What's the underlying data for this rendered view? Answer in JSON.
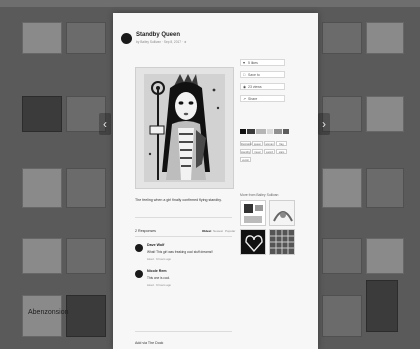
{
  "artwork": {
    "title": "Standby Queen",
    "byline": "by Bailey Sullivan · Sep 8, 2017 · ★",
    "caption": "The feeling when a girl finally confirmed flying standby."
  },
  "actions": [
    {
      "icon": "heart-icon",
      "label": "5 likes"
    },
    {
      "icon": "bookmark-icon",
      "label": "Save to"
    },
    {
      "icon": "eye-icon",
      "label": "23 views"
    },
    {
      "icon": "share-icon",
      "label": "Share"
    }
  ],
  "palette": [
    "#111111",
    "#3a3a3a",
    "#b5b5b5",
    "#d8d8d8",
    "#8f8f8f",
    "#5c5c5c"
  ],
  "tags": [
    "illustration",
    "queen",
    "woman",
    "flag",
    "standby",
    "travel",
    "sword",
    "stars",
    "vector"
  ],
  "more_from": {
    "label": "More from Bailey Sullivan"
  },
  "responses": {
    "count_label": "2 Responses",
    "sort": [
      "Oldest",
      "Newest",
      "Popular"
    ],
    "items": [
      {
        "name": "Dave Wolf",
        "text": "What! This girl was freaking cool stuff dreams!!",
        "meta": "Liked · 9 hours ago"
      },
      {
        "name": "Nicole Rem",
        "text": "This one is cool.",
        "meta": "Liked · 9 hours ago"
      }
    ]
  },
  "footer": {
    "label": "Add via The Dock"
  },
  "background": {
    "caption_left": "Abenzonsion"
  },
  "colors": {
    "overlay": "#5a5a5a",
    "modal": "#f7f7f7",
    "ink": "#111111"
  }
}
